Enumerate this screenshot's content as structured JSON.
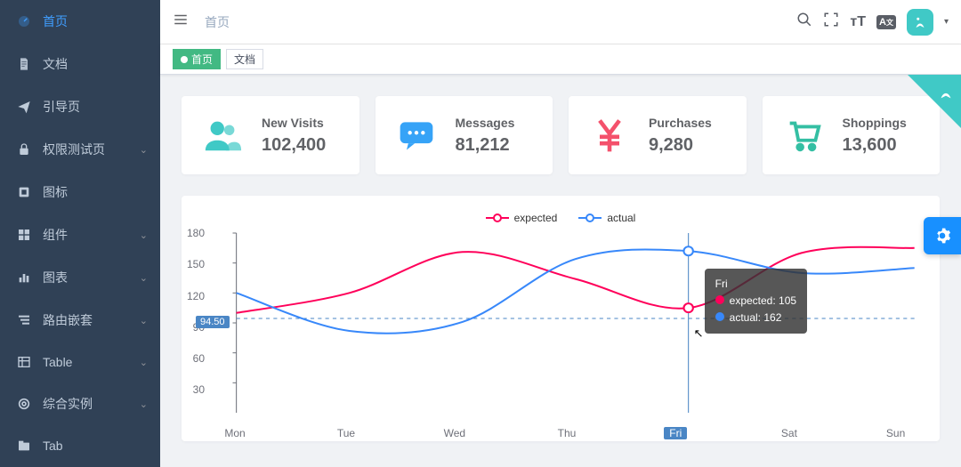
{
  "sidebar": {
    "items": [
      {
        "label": "首页",
        "icon": "dashboard",
        "active": true,
        "has_children": false
      },
      {
        "label": "文档",
        "icon": "document",
        "active": false,
        "has_children": false
      },
      {
        "label": "引导页",
        "icon": "send",
        "active": false,
        "has_children": false
      },
      {
        "label": "权限测试页",
        "icon": "lock",
        "active": false,
        "has_children": true
      },
      {
        "label": "图标",
        "icon": "square",
        "active": false,
        "has_children": false
      },
      {
        "label": "组件",
        "icon": "grid",
        "active": false,
        "has_children": true
      },
      {
        "label": "图表",
        "icon": "bars",
        "active": false,
        "has_children": true
      },
      {
        "label": "路由嵌套",
        "icon": "nested",
        "active": false,
        "has_children": true
      },
      {
        "label": "Table",
        "icon": "table",
        "active": false,
        "has_children": true
      },
      {
        "label": "综合实例",
        "icon": "ring",
        "active": false,
        "has_children": true
      },
      {
        "label": "Tab",
        "icon": "tab",
        "active": false,
        "has_children": false
      }
    ]
  },
  "navbar": {
    "breadcrumb": "首页"
  },
  "tags": {
    "items": [
      {
        "label": "首页",
        "active": true
      },
      {
        "label": "文档",
        "active": false
      }
    ]
  },
  "panels": [
    {
      "label": "New Visits",
      "value": "102,400",
      "icon": "people",
      "color": "#40c9c6"
    },
    {
      "label": "Messages",
      "value": "81,212",
      "icon": "message",
      "color": "#36a3f7"
    },
    {
      "label": "Purchases",
      "value": "9,280",
      "icon": "money",
      "color": "#f4516c"
    },
    {
      "label": "Shoppings",
      "value": "13,600",
      "icon": "cart",
      "color": "#34bfa3"
    }
  ],
  "chart_data": {
    "type": "line",
    "categories": [
      "Mon",
      "Tue",
      "Wed",
      "Thu",
      "Fri",
      "Sat",
      "Sun"
    ],
    "series": [
      {
        "name": "expected",
        "color": "#ff005a",
        "values": [
          100,
          120,
          161,
          134,
          105,
          160,
          165
        ]
      },
      {
        "name": "actual",
        "color": "#3888fa",
        "values": [
          120,
          82,
          91,
          154,
          162,
          140,
          145
        ]
      }
    ],
    "ylim": [
      0,
      180
    ],
    "yticks": [
      30,
      60,
      90,
      120,
      150,
      180
    ],
    "marker_line": {
      "value": 94.5,
      "label": "94.50"
    },
    "highlight_category": "Fri",
    "tooltip": {
      "title": "Fri",
      "rows": [
        {
          "name": "expected",
          "value": 105,
          "color": "#ff005a"
        },
        {
          "name": "actual",
          "value": 162,
          "color": "#3888fa"
        }
      ]
    }
  }
}
